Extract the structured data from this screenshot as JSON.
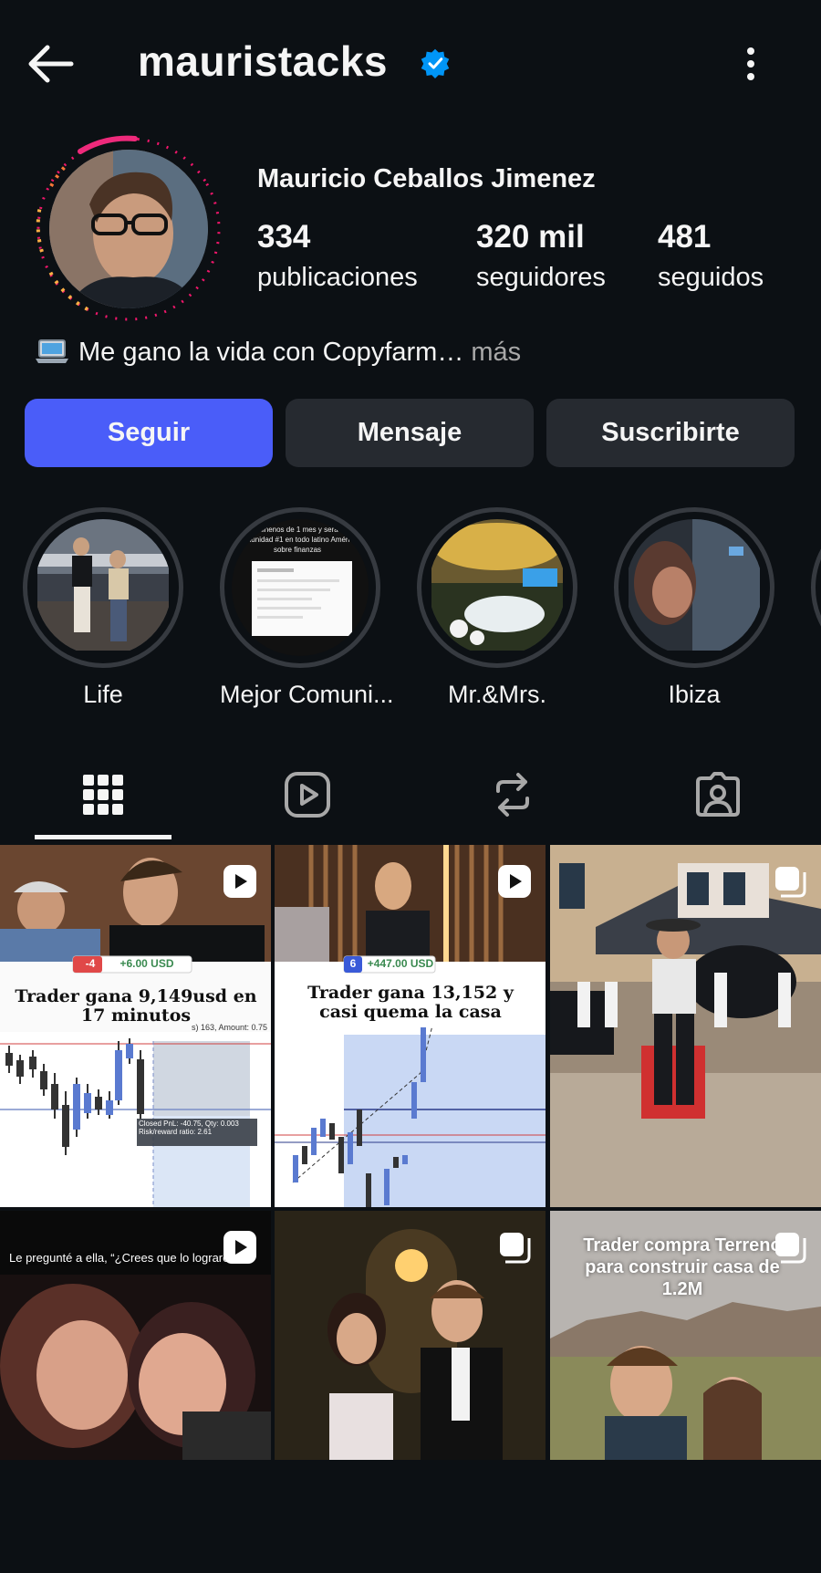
{
  "header": {
    "username": "mauristacks",
    "verified": true,
    "back_icon": "arrow-left-icon",
    "more_icon": "more-vertical-icon"
  },
  "profile": {
    "full_name": "Mauricio Ceballos Jimenez",
    "stats": [
      {
        "count": "334",
        "label": "publicaciones"
      },
      {
        "count": "320 mil",
        "label": "seguidores"
      },
      {
        "count": "481",
        "label": "seguidos"
      }
    ],
    "bio": "Me gano la vida con Copyfarm…",
    "bio_more": "más",
    "bio_icon": "laptop-emoji"
  },
  "actions": {
    "follow_label": "Seguir",
    "message_label": "Mensaje",
    "subscribe_label": "Suscribirte"
  },
  "highlights": [
    {
      "label": "Life"
    },
    {
      "label": "Mejor Comuni..."
    },
    {
      "label": "Mr.&Mrs."
    },
    {
      "label": "Ibiza"
    }
  ],
  "highlight_texts": {
    "mejor_line1": "minenos de 1 mes y sera",
    "mejor_line2": "munidad #1 en todo latino Améri",
    "mejor_line3": "sobre finanzas"
  },
  "tabs": [
    {
      "name": "grid",
      "icon": "grid-icon",
      "active": true
    },
    {
      "name": "reels",
      "icon": "reels-icon",
      "active": false
    },
    {
      "name": "reposts",
      "icon": "repost-icon",
      "active": false
    },
    {
      "name": "tagged",
      "icon": "tagged-user-icon",
      "active": false
    }
  ],
  "posts": [
    {
      "type": "reel",
      "badge_icon": "reel-icon",
      "title": "Trader gana 9,149usd en 17 minutos",
      "tag_left": "-4",
      "tag_right": "+6.00 USD",
      "chart_note": "Closed PnL: -40.75, Qty: 0.003",
      "chart_note2": "Risk/reward ratio: 2.61",
      "side_note": "s) 163, Amount: 0.75"
    },
    {
      "type": "reel",
      "badge_icon": "reel-icon",
      "title": "Trader gana 13,152 y casi quema la casa",
      "tag_left": "6",
      "tag_right": "+447.00 USD"
    },
    {
      "type": "carousel",
      "badge_icon": "carousel-icon"
    },
    {
      "type": "reel",
      "badge_icon": "reel-icon",
      "caption": "Le pregunté a ella, “¿Crees que lo lograre"
    },
    {
      "type": "carousel",
      "badge_icon": "carousel-icon"
    },
    {
      "type": "carousel",
      "badge_icon": "carousel-icon",
      "caption": "Trader compra Terreno para construir casa de 1.2M"
    }
  ],
  "colors": {
    "background": "#0c1014",
    "primary_button": "#4a5df9",
    "secondary_button": "#262a30",
    "verified": "#0095f6",
    "text_muted": "#a8a8a8"
  }
}
